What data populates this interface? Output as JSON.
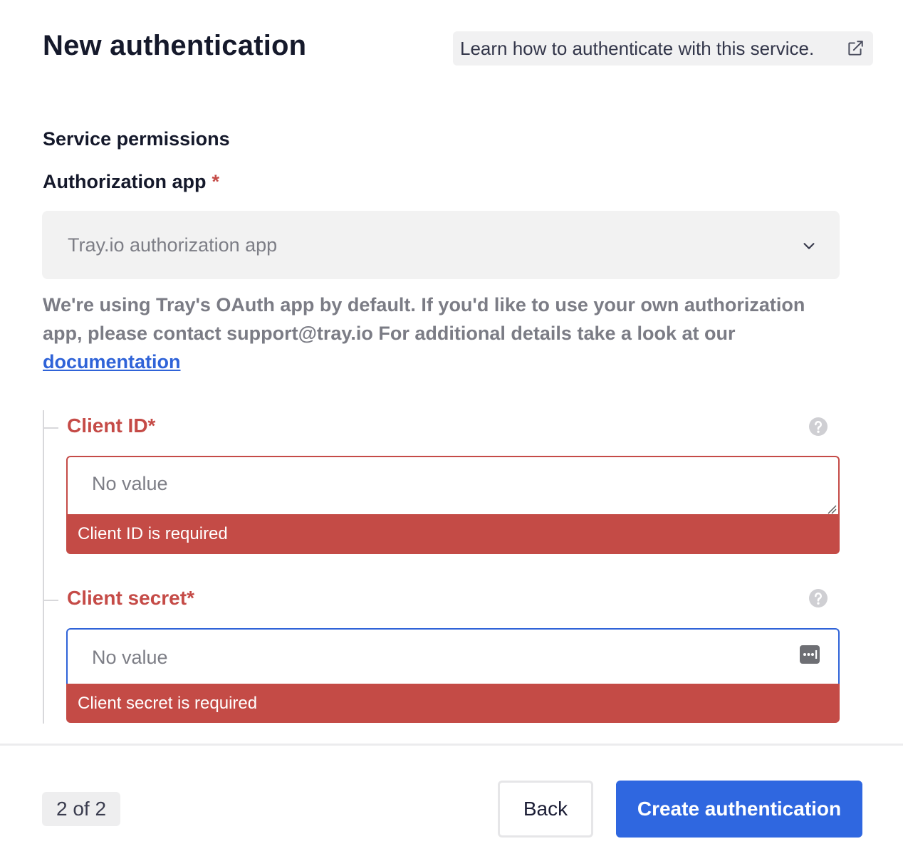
{
  "header": {
    "title": "New authentication",
    "learn_link": "Learn how to authenticate with this service.",
    "learn_icon": "external-link-icon"
  },
  "form": {
    "section_title": "Service permissions",
    "auth_app": {
      "label": "Authorization app",
      "required_mark": "*",
      "selected": "Tray.io authorization app",
      "help_text": "We're using Tray's OAuth app by default. If you'd like to use your own authorization app, please contact support@tray.io For additional details take a look at our",
      "help_link": "documentation"
    },
    "client_id": {
      "label": "Client ID*",
      "placeholder": "No value",
      "error": "Client ID is required"
    },
    "client_secret": {
      "label": "Client secret*",
      "placeholder": "No value",
      "error": "Client secret is required"
    }
  },
  "footer": {
    "step": "2 of 2",
    "back_label": "Back",
    "create_label": "Create authentication"
  },
  "colors": {
    "accent": "#2f67e0",
    "error": "#c44b46",
    "link": "#2f63d8"
  }
}
